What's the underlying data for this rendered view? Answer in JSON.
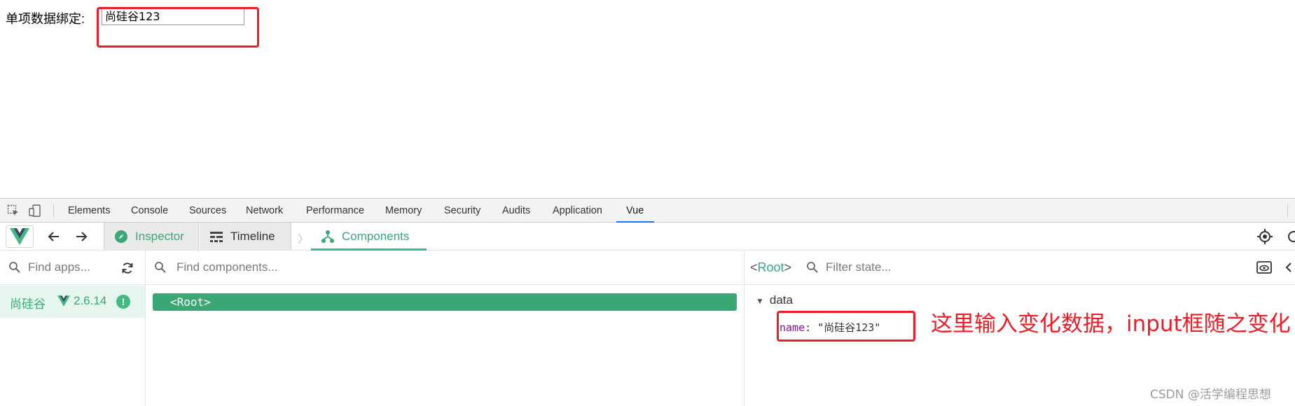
{
  "page": {
    "bind_label": "单项数据绑定:",
    "input_value": "尚硅谷123"
  },
  "devtools": {
    "tabs": [
      "Elements",
      "Console",
      "Sources",
      "Network",
      "Performance",
      "Memory",
      "Security",
      "Audits",
      "Application",
      "Vue"
    ],
    "active_tab": "Vue",
    "icons": [
      "inspect-element-icon",
      "device-toggle-icon"
    ]
  },
  "vue_toolbar": {
    "inspector_label": "Inspector",
    "timeline_label": "Timeline",
    "components_label": "Components",
    "icons": [
      "vue-logo-icon",
      "back-arrow-icon",
      "forward-arrow-icon",
      "compass-icon",
      "timeline-icon",
      "components-tree-icon",
      "target-icon",
      "refresh-circle-icon"
    ]
  },
  "apps_pane": {
    "search_placeholder": "Find apps...",
    "app_name": "尚硅谷",
    "app_version": "2.6.14",
    "badge": "!"
  },
  "components_pane": {
    "search_placeholder": "Find components...",
    "root_label": "<Root>"
  },
  "state_pane": {
    "selected_component": "Root",
    "filter_placeholder": "Filter state...",
    "section": "data",
    "key": "name",
    "value": "\"尚硅谷123\"",
    "annotation": "这里输入变化数据，input框随之变化"
  },
  "watermark": "CSDN @活学编程思想",
  "colors": {
    "vue_green": "#42b883",
    "vue_green_dark": "#3ba776",
    "annotation_red": "#ee1c25",
    "key_purple": "#881391"
  }
}
